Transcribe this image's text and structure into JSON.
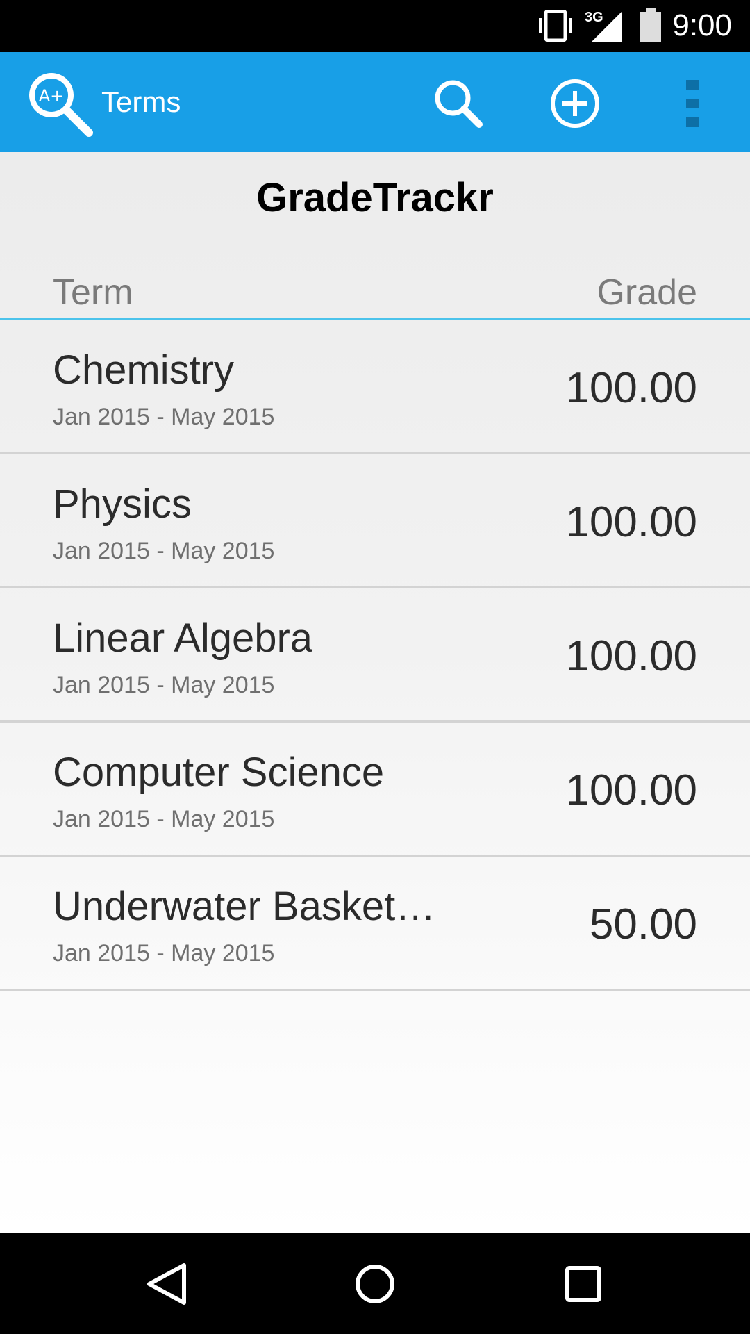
{
  "status_bar": {
    "time": "9:00",
    "network": "3G",
    "icons": [
      "vibrate-icon",
      "cell-signal-icon",
      "battery-icon"
    ]
  },
  "app_bar": {
    "title": "Terms",
    "background": "#189FE7",
    "logo_icon": "magnifier-grade-logo-icon",
    "logo_text": "A+",
    "actions": [
      "search-icon",
      "add-circle-icon",
      "overflow-menu-icon"
    ]
  },
  "main": {
    "title": "GradeTrackr",
    "columns": {
      "term": "Term",
      "grade": "Grade"
    },
    "divider_color": "#4CC3EB",
    "rows": [
      {
        "name": "Chemistry",
        "dates": "Jan 2015 - May 2015",
        "grade": "100.00"
      },
      {
        "name": "Physics",
        "dates": "Jan 2015 - May 2015",
        "grade": "100.00"
      },
      {
        "name": "Linear Algebra",
        "dates": "Jan 2015 - May 2015",
        "grade": "100.00"
      },
      {
        "name": "Computer Science",
        "dates": "Jan 2015 - May 2015",
        "grade": "100.00"
      },
      {
        "name": "Underwater Basket…",
        "dates": "Jan 2015 - May 2015",
        "grade": "50.00"
      }
    ]
  },
  "nav_bar": {
    "buttons": [
      "back-icon",
      "home-icon",
      "recents-icon"
    ]
  }
}
